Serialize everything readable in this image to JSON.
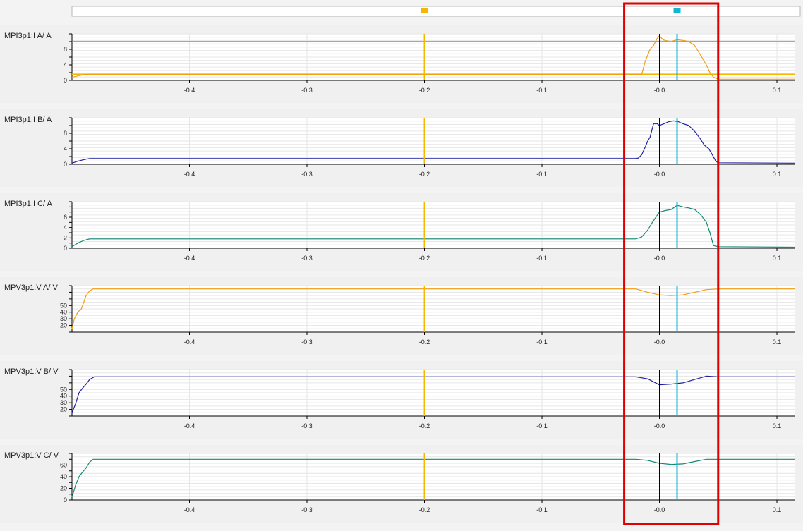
{
  "colors": {
    "cursor_a": "#f5b800",
    "cursor_b": "#15b4d6",
    "orange": "#f39c12",
    "blue": "#1f1f9e",
    "teal": "#128a74",
    "highlight": "#e00000",
    "axis": "#000000"
  },
  "cursors": {
    "a_x": -0.2,
    "b_x": 0.015
  },
  "top_bar": {
    "markers": [
      {
        "x": -0.2,
        "color_key": "cursor_a"
      },
      {
        "x": 0.015,
        "color_key": "cursor_b"
      }
    ]
  },
  "highlight_region": {
    "x_start": -0.03,
    "x_end": 0.05
  },
  "chart_data": [
    {
      "type": "line",
      "title": "MPI3p1:I A/ A",
      "xlim": [
        -0.5,
        0.115
      ],
      "ylim": [
        0,
        12
      ],
      "yticks": [
        0,
        2,
        4,
        6,
        8,
        10,
        12
      ],
      "ytick_labels": [
        "0",
        "4",
        "8"
      ],
      "xticks": [
        -0.4,
        -0.3,
        -0.2,
        -0.1,
        0.0,
        0.1
      ],
      "xtick_labels": [
        "-0.4",
        "-0.3",
        "-0.2",
        "-0.1",
        "-0.0",
        "0.1"
      ],
      "grid": true,
      "series": [
        {
          "color_key": "orange",
          "x": [
            -0.5,
            -0.49,
            -0.485,
            -0.02,
            -0.015,
            -0.012,
            -0.008,
            -0.005,
            -0.002,
            0.0,
            0.003,
            0.006,
            0.01,
            0.015,
            0.02,
            0.025,
            0.03,
            0.033,
            0.036,
            0.04,
            0.043,
            0.046,
            0.05,
            0.115
          ],
          "y": [
            0.8,
            1.5,
            1.6,
            1.6,
            1.6,
            5.0,
            8.0,
            9.0,
            10.8,
            11.5,
            10.5,
            10.2,
            10.0,
            10.5,
            10.3,
            10.0,
            9.0,
            7.5,
            6.0,
            4.0,
            2.0,
            0.8,
            0.3,
            0.3
          ]
        }
      ],
      "hlines": [
        {
          "y": 10.0,
          "color_key": "cursor_b"
        },
        {
          "y": 1.6,
          "color_key": "cursor_a"
        }
      ]
    },
    {
      "type": "line",
      "title": "MPI3p1:I B/ A",
      "xlim": [
        -0.5,
        0.115
      ],
      "ylim": [
        0,
        12
      ],
      "yticks": [
        0,
        2,
        4,
        6,
        8,
        10,
        12
      ],
      "ytick_labels": [
        "0",
        "4",
        "8"
      ],
      "xticks": [
        -0.4,
        -0.3,
        -0.2,
        -0.1,
        0.0,
        0.1
      ],
      "xtick_labels": [
        "-0.4",
        "-0.3",
        "-0.2",
        "-0.1",
        "-0.0",
        "0.1"
      ],
      "grid": true,
      "series": [
        {
          "color_key": "blue",
          "x": [
            -0.5,
            -0.495,
            -0.49,
            -0.485,
            -0.02,
            -0.018,
            -0.015,
            -0.012,
            -0.01,
            -0.008,
            -0.005,
            -0.002,
            0.0,
            0.004,
            0.008,
            0.012,
            0.016,
            0.02,
            0.025,
            0.03,
            0.035,
            0.038,
            0.042,
            0.045,
            0.048,
            0.05,
            0.115
          ],
          "y": [
            0.3,
            0.8,
            1.2,
            1.5,
            1.5,
            1.6,
            2.5,
            4.5,
            6.0,
            7.0,
            10.5,
            10.5,
            10.0,
            10.5,
            11.0,
            11.2,
            11.0,
            10.5,
            10.0,
            8.5,
            6.5,
            5.0,
            4.0,
            2.5,
            0.8,
            0.4,
            0.3
          ]
        }
      ]
    },
    {
      "type": "line",
      "title": "MPI3p1:I C/ A",
      "xlim": [
        -0.5,
        0.115
      ],
      "ylim": [
        0,
        9
      ],
      "yticks": [
        0,
        1,
        2,
        3,
        4,
        5,
        6,
        7,
        8,
        9
      ],
      "ytick_labels": [
        "0",
        "2",
        "4",
        "6"
      ],
      "xticks": [
        -0.4,
        -0.3,
        -0.2,
        -0.1,
        0.0,
        0.1
      ],
      "xtick_labels": [
        "-0.4",
        "-0.3",
        "-0.2",
        "-0.1",
        "-0.0",
        "0.1"
      ],
      "grid": true,
      "series": [
        {
          "color_key": "teal",
          "x": [
            -0.5,
            -0.495,
            -0.49,
            -0.485,
            -0.02,
            -0.015,
            -0.01,
            -0.006,
            -0.003,
            0.0,
            0.005,
            0.01,
            0.015,
            0.02,
            0.025,
            0.03,
            0.035,
            0.04,
            0.043,
            0.046,
            0.05,
            0.115
          ],
          "y": [
            0.3,
            1.0,
            1.5,
            1.8,
            1.8,
            2.2,
            3.5,
            5.0,
            6.0,
            7.0,
            7.3,
            7.5,
            8.3,
            8.0,
            7.8,
            7.5,
            6.5,
            5.0,
            3.0,
            0.5,
            0.3,
            0.2
          ]
        }
      ]
    },
    {
      "type": "line",
      "title": "MPV3p1:V A/ V",
      "xlim": [
        -0.5,
        0.115
      ],
      "ylim": [
        10,
        80
      ],
      "yticks": [
        10,
        20,
        30,
        40,
        50,
        60,
        70,
        80
      ],
      "ytick_labels": [
        "20",
        "30",
        "40",
        "50"
      ],
      "xticks": [
        -0.4,
        -0.3,
        -0.2,
        -0.1,
        0.0,
        0.1
      ],
      "xtick_labels": [
        "-0.4",
        "-0.3",
        "-0.2",
        "-0.1",
        "-0.0",
        "0.1"
      ],
      "grid": true,
      "series": [
        {
          "color_key": "orange",
          "x": [
            -0.5,
            -0.498,
            -0.495,
            -0.492,
            -0.49,
            -0.488,
            -0.485,
            -0.482,
            -0.02,
            -0.01,
            0.0,
            0.01,
            0.02,
            0.03,
            0.04,
            0.05,
            0.115
          ],
          "y": [
            15,
            30,
            40,
            45,
            55,
            65,
            72,
            75,
            75,
            70,
            66,
            65,
            66,
            70,
            74,
            75,
            75
          ]
        }
      ]
    },
    {
      "type": "line",
      "title": "MPV3p1:V B/ V",
      "xlim": [
        -0.5,
        0.115
      ],
      "ylim": [
        10,
        80
      ],
      "yticks": [
        10,
        20,
        30,
        40,
        50,
        60,
        70,
        80
      ],
      "ytick_labels": [
        "20",
        "30",
        "40",
        "50"
      ],
      "xticks": [
        -0.4,
        -0.3,
        -0.2,
        -0.1,
        0.0,
        0.1
      ],
      "xtick_labels": [
        "-0.4",
        "-0.3",
        "-0.2",
        "-0.1",
        "-0.0",
        "0.1"
      ],
      "grid": true,
      "series": [
        {
          "color_key": "blue",
          "x": [
            -0.5,
            -0.497,
            -0.494,
            -0.491,
            -0.488,
            -0.485,
            -0.481,
            -0.02,
            -0.01,
            0.0,
            0.01,
            0.02,
            0.03,
            0.04,
            0.05,
            0.115
          ],
          "y": [
            15,
            28,
            45,
            52,
            58,
            65,
            69,
            69,
            66,
            57,
            58,
            60,
            65,
            70,
            69,
            69
          ]
        }
      ]
    },
    {
      "type": "line",
      "title": "MPV3p1:V C/ V",
      "xlim": [
        -0.5,
        0.115
      ],
      "ylim": [
        0,
        80
      ],
      "yticks": [
        0,
        10,
        20,
        30,
        40,
        50,
        60,
        70,
        80
      ],
      "ytick_labels": [
        "0",
        "20",
        "40",
        "60"
      ],
      "xticks": [
        -0.4,
        -0.3,
        -0.2,
        -0.1,
        0.0,
        0.1
      ],
      "xtick_labels": [
        "-0.4",
        "-0.3",
        "-0.2",
        "-0.1",
        "-0.0",
        "0.1"
      ],
      "grid": true,
      "series": [
        {
          "color_key": "teal",
          "x": [
            -0.5,
            -0.497,
            -0.494,
            -0.491,
            -0.488,
            -0.485,
            -0.482,
            -0.02,
            -0.01,
            0.0,
            0.01,
            0.02,
            0.03,
            0.04,
            0.05,
            0.115
          ],
          "y": [
            5,
            25,
            40,
            48,
            55,
            65,
            70,
            70,
            68,
            63,
            61,
            62,
            66,
            70,
            70,
            70
          ]
        }
      ]
    }
  ]
}
